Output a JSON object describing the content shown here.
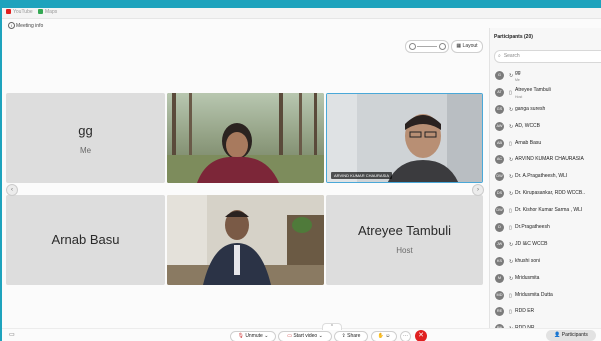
{
  "bookmarks": [
    {
      "label": "YouTube",
      "color": "#e02020"
    },
    {
      "label": "Maps",
      "color": "#34a853"
    }
  ],
  "meeting_info": "Meeting info",
  "layout_label": "Layout",
  "tiles": {
    "gg": {
      "name": "gg",
      "sub": "Me"
    },
    "arnab": {
      "name": "Arnab Basu"
    },
    "atreyee": {
      "name": "Atreyee Tambuli",
      "sub": "Host"
    },
    "arvind_tag": "ARVIND KUMAR CHAURASIA"
  },
  "panel": {
    "title": "Participants (20)",
    "search_placeholder": "Search",
    "participants": [
      {
        "initials": "G",
        "name": "gg",
        "role": "Me",
        "device": "phone-call-icon",
        "color": "#7e7e7e"
      },
      {
        "initials": "AT",
        "name": "Atreyee Tambuli",
        "role": "Host",
        "device": "phone-icon",
        "color": "#7e7e7e"
      },
      {
        "initials": "GS",
        "name": "ganga suresh",
        "role": "",
        "device": "phone-call-icon",
        "color": "#7e7e7e"
      },
      {
        "initials": "AW",
        "name": "AD, WCCB",
        "role": "",
        "device": "phone-call-icon",
        "color": "#7e7e7e"
      },
      {
        "initials": "AB",
        "name": "Arnab Basu",
        "role": "",
        "device": "phone-icon",
        "color": "#7e7e7e"
      },
      {
        "initials": "AC",
        "name": "ARVIND KUMAR CHAURASIA",
        "role": "",
        "device": "phone-call-icon",
        "color": "#7e7e7e"
      },
      {
        "initials": "DW",
        "name": "Dr. A.Pragatheesh, WLI",
        "role": "",
        "device": "phone-call-icon",
        "color": "#7e7e7e"
      },
      {
        "initials": "DS",
        "name": "Dr. Kirupasankar, RDD WCCB..",
        "role": "",
        "device": "phone-call-icon",
        "color": "#7e7e7e"
      },
      {
        "initials": "DW",
        "name": "Dr. Kishor Kumar Sarma , WLI",
        "role": "",
        "device": "phone-icon",
        "color": "#7e7e7e"
      },
      {
        "initials": "D",
        "name": "Dr.Pragatheesh",
        "role": "",
        "device": "phone-icon",
        "color": "#7e7e7e"
      },
      {
        "initials": "JW",
        "name": "JD I&C WCCB",
        "role": "",
        "device": "phone-call-icon",
        "color": "#7e7e7e"
      },
      {
        "initials": "KS",
        "name": "khushi soni",
        "role": "",
        "device": "phone-call-icon",
        "color": "#7e7e7e"
      },
      {
        "initials": "M",
        "name": "Mridusmita",
        "role": "",
        "device": "phone-call-icon",
        "color": "#7e7e7e"
      },
      {
        "initials": "MD",
        "name": "Mridusmita Dutta",
        "role": "",
        "device": "phone-icon",
        "color": "#7e7e7e"
      },
      {
        "initials": "RE",
        "name": "RDD ER",
        "role": "",
        "device": "phone-icon",
        "color": "#7e7e7e"
      },
      {
        "initials": "RN",
        "name": "RDD NR",
        "role": "",
        "device": "phone-call-icon",
        "color": "#7e7e7e"
      }
    ]
  },
  "bottombar": {
    "unmute": "Unmute",
    "start_video": "Start video",
    "share": "Share",
    "participants": "Participants"
  }
}
